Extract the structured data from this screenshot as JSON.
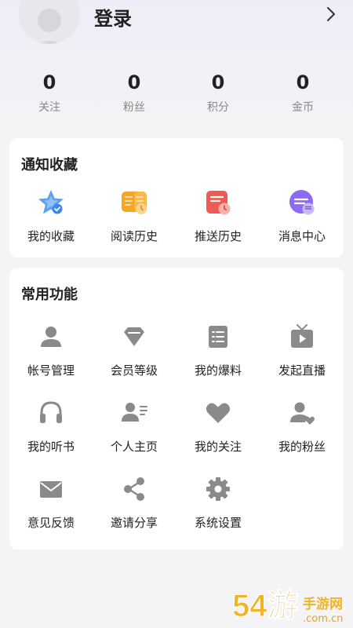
{
  "profile": {
    "login_label": "登录"
  },
  "stats": [
    {
      "value": "0",
      "label": "关注"
    },
    {
      "value": "0",
      "label": "粉丝"
    },
    {
      "value": "0",
      "label": "积分"
    },
    {
      "value": "0",
      "label": "金币"
    }
  ],
  "notify": {
    "title": "通知收藏",
    "items": [
      {
        "label": "我的收藏",
        "icon": "star-icon"
      },
      {
        "label": "阅读历史",
        "icon": "book-icon"
      },
      {
        "label": "推送历史",
        "icon": "push-history-icon"
      },
      {
        "label": "消息中心",
        "icon": "message-icon"
      }
    ]
  },
  "functions": {
    "title": "常用功能",
    "items": [
      {
        "label": "帐号管理",
        "icon": "user-icon"
      },
      {
        "label": "会员等级",
        "icon": "diamond-icon"
      },
      {
        "label": "我的爆料",
        "icon": "list-icon"
      },
      {
        "label": "发起直播",
        "icon": "tv-icon"
      },
      {
        "label": "我的听书",
        "icon": "headphones-icon"
      },
      {
        "label": "个人主页",
        "icon": "profile-card-icon"
      },
      {
        "label": "我的关注",
        "icon": "heart-icon"
      },
      {
        "label": "我的粉丝",
        "icon": "user-heart-icon"
      },
      {
        "label": "意见反馈",
        "icon": "mail-icon"
      },
      {
        "label": "邀请分享",
        "icon": "share-icon"
      },
      {
        "label": "系统设置",
        "icon": "gear-icon"
      }
    ]
  },
  "watermark": {
    "text": "54游手游网",
    "domain": ".com.cn"
  },
  "colors": {
    "icon_gray": "#8a8a8a",
    "watermark": "#f0b429"
  }
}
